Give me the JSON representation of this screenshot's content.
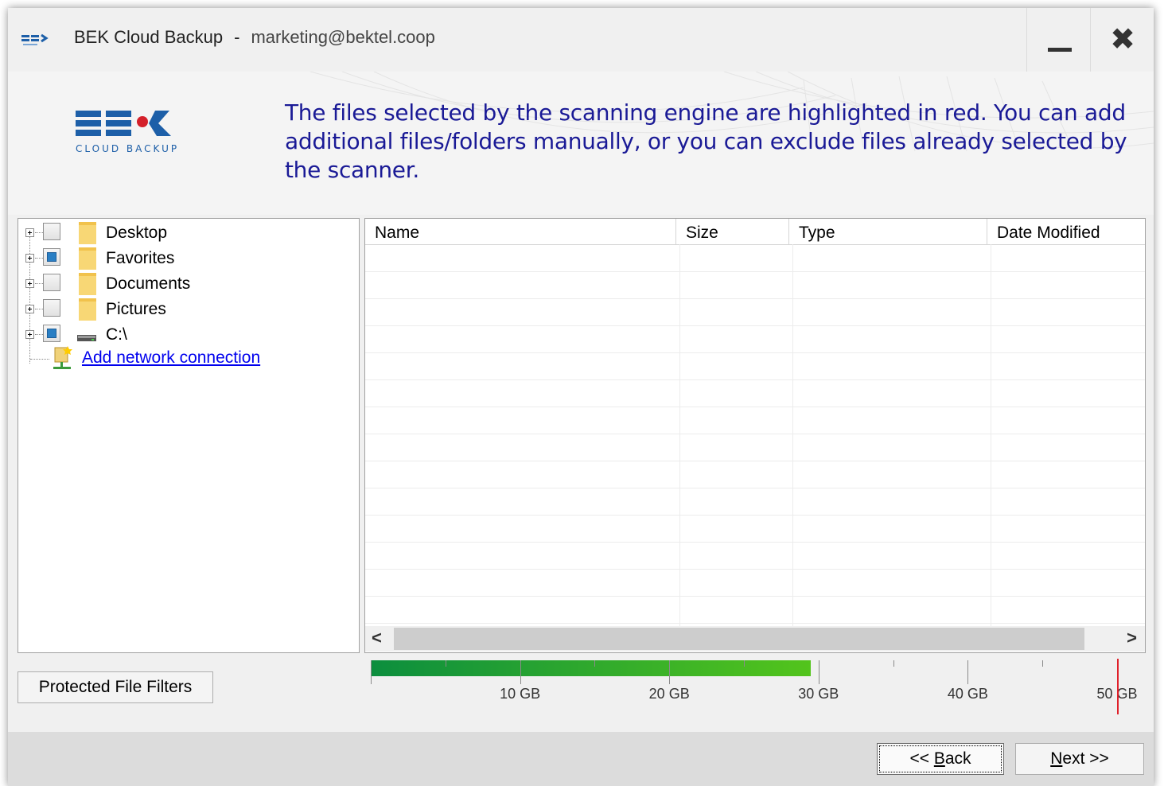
{
  "window": {
    "app_name": "BEK Cloud Backup",
    "separator": "-",
    "account": "marketing@bektel.coop"
  },
  "titlebar": {
    "logo_text": "BEK",
    "minimize_icon": "minimize-icon",
    "close_icon": "close-icon",
    "close_glyph": "✖"
  },
  "header": {
    "logo_text": "BEK",
    "logo_subtext": "CLOUD BACKUP",
    "message": "The files selected by the scanning engine are highlighted in red.  You can add additional files/folders manually, or you can exclude files already selected by the scanner."
  },
  "tree": {
    "items": [
      {
        "label": "Desktop",
        "checked": "unchecked",
        "icon": "folder-icon"
      },
      {
        "label": "Favorites",
        "checked": "partial",
        "icon": "folder-icon"
      },
      {
        "label": "Documents",
        "checked": "unchecked",
        "icon": "folder-icon"
      },
      {
        "label": "Pictures",
        "checked": "unchecked",
        "icon": "folder-icon"
      },
      {
        "label": "C:\\",
        "checked": "partial",
        "icon": "drive-icon"
      }
    ],
    "add_network_label": "Add network connection"
  },
  "file_list": {
    "columns": [
      "Name",
      "Size",
      "Type",
      "Date Modified"
    ],
    "rows": [],
    "scroll_left": "<",
    "scroll_right": ">"
  },
  "gauge": {
    "used_gb": 29.5,
    "max_gb": 50,
    "ticks": [
      "10 GB",
      "20 GB",
      "30 GB",
      "40 GB",
      "50 GB"
    ],
    "fill_start_color": "#0c8e3e",
    "fill_end_color": "#53c41c",
    "limit_color": "#e0202a"
  },
  "buttons": {
    "protected_filters": "Protected File Filters",
    "back_prefix": "<< ",
    "back_accel": "B",
    "back_rest": "ack",
    "next_accel": "N",
    "next_rest": "ext >>"
  }
}
